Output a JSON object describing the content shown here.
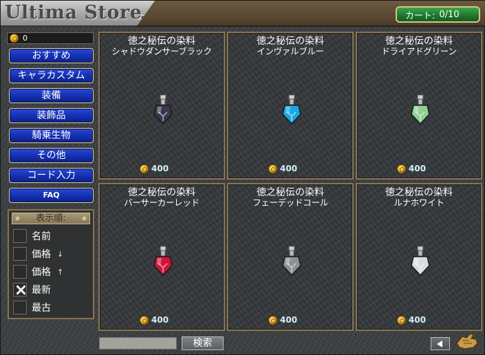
{
  "header": {
    "title": "Ultima Store",
    "cart_label": "カート:",
    "cart_count": "0/10"
  },
  "balance": {
    "value": "0"
  },
  "sidebar": {
    "items": [
      {
        "label": "おすすめ"
      },
      {
        "label": "キャラカスタム"
      },
      {
        "label": "装備"
      },
      {
        "label": "装飾品"
      },
      {
        "label": "騎乗生物"
      },
      {
        "label": "その他"
      },
      {
        "label": "コード入力"
      },
      {
        "label": "FAQ"
      }
    ]
  },
  "sort": {
    "title": "表示順:",
    "options": [
      {
        "label": "名前",
        "arrow": "",
        "checked": false
      },
      {
        "label": "価格",
        "arrow": "↓",
        "checked": false
      },
      {
        "label": "価格",
        "arrow": "↑",
        "checked": false
      },
      {
        "label": "最新",
        "arrow": "",
        "checked": true
      },
      {
        "label": "最古",
        "arrow": "",
        "checked": false
      }
    ]
  },
  "products": [
    {
      "title": "徳之秘伝の染料",
      "subtitle": "シャドウダンサーブラック",
      "price": "400",
      "color": "#3a3650"
    },
    {
      "title": "徳之秘伝の染料",
      "subtitle": "インヴァルブルー",
      "price": "400",
      "color": "#1aa6e0"
    },
    {
      "title": "徳之秘伝の染料",
      "subtitle": "ドライアドグリーン",
      "price": "400",
      "color": "#8fcf95"
    },
    {
      "title": "徳之秘伝の染料",
      "subtitle": "バーサーカーレッド",
      "price": "400",
      "color": "#d0143a"
    },
    {
      "title": "徳之秘伝の染料",
      "subtitle": "フェーデッドコール",
      "price": "400",
      "color": "#8d8f92"
    },
    {
      "title": "徳之秘伝の染料",
      "subtitle": "ルナホワイト",
      "price": "400",
      "color": "#d9dadc"
    }
  ],
  "search": {
    "value": "",
    "button_label": "検索"
  },
  "icons": {
    "balance": "coin-icon",
    "prev": "arrow-left-icon",
    "corner": "hand-glove-icon",
    "bottle": "dye-bottle-icon"
  }
}
